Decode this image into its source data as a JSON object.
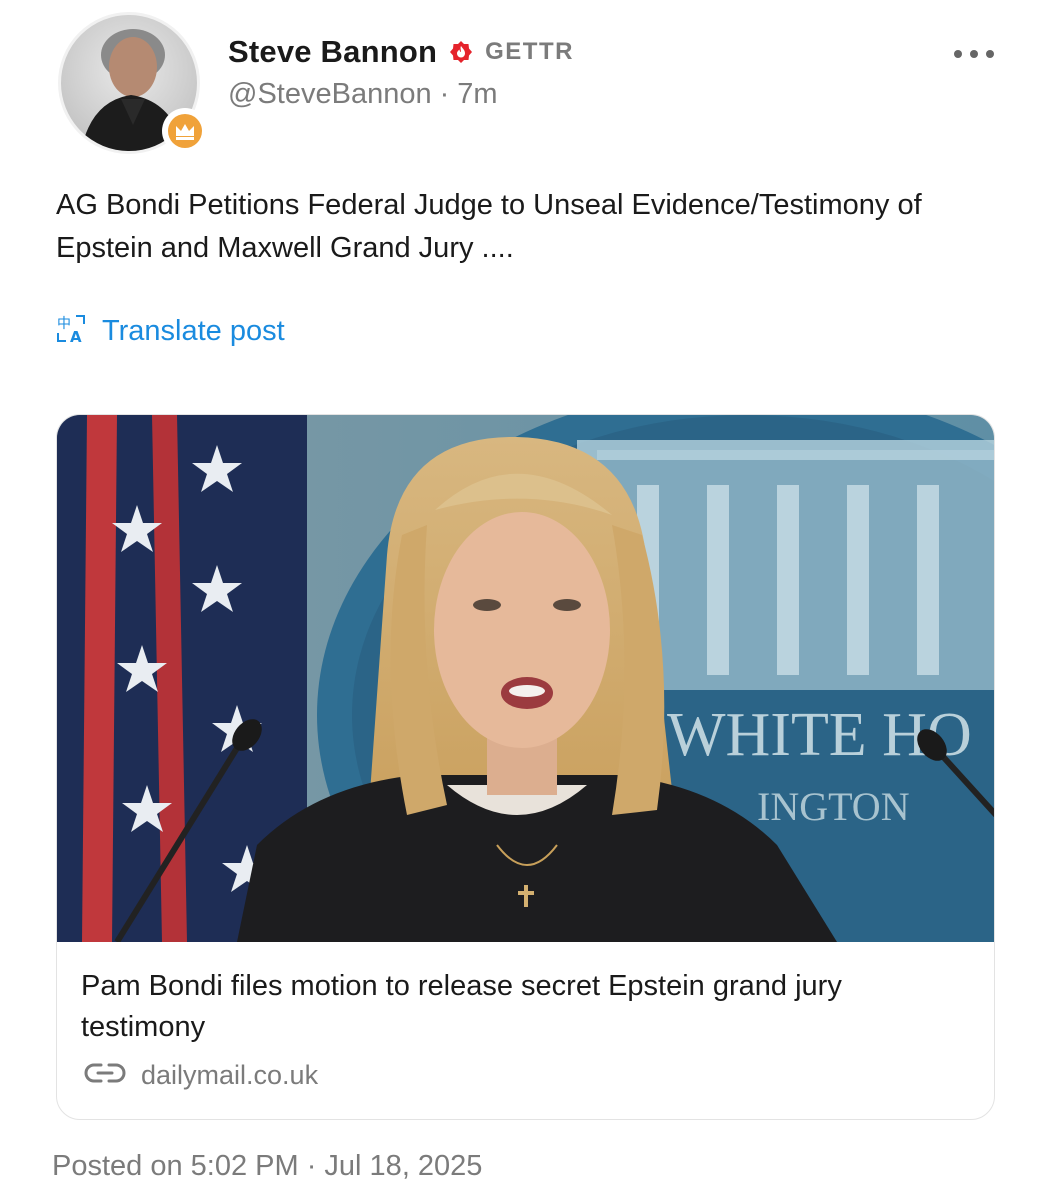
{
  "author": {
    "name": "Steve Bannon",
    "platform": "GETTR",
    "handle": "@SteveBannon",
    "separator": "·",
    "time_ago": "7m",
    "verified_color": "#e5232c",
    "badge_color": "#f0a23a"
  },
  "post": {
    "text": "AG Bondi Petitions Federal Judge to Unseal Evidence/Testimony of Epstein and Maxwell Grand Jury ....",
    "translate_label": "Translate post"
  },
  "link_card": {
    "title": "Pam Bondi files motion to release secret Epstein grand jury testimony",
    "source": "dailymail.co.uk",
    "image_sign_text_1": "WHITE HO",
    "image_sign_text_2": "INGTON"
  },
  "footer": {
    "posted": "Posted on 5:02 PM · Jul 18, 2025"
  },
  "icons": {
    "avatar": "profile-photo-icon",
    "badge": "crown-icon",
    "verified": "verified-flame-icon",
    "more": "more-dots-icon",
    "translate": "translate-icon",
    "link": "link-icon"
  },
  "colors": {
    "accent": "#1a8bdf",
    "muted": "#7b7b7b",
    "text": "#1a1a1a"
  }
}
